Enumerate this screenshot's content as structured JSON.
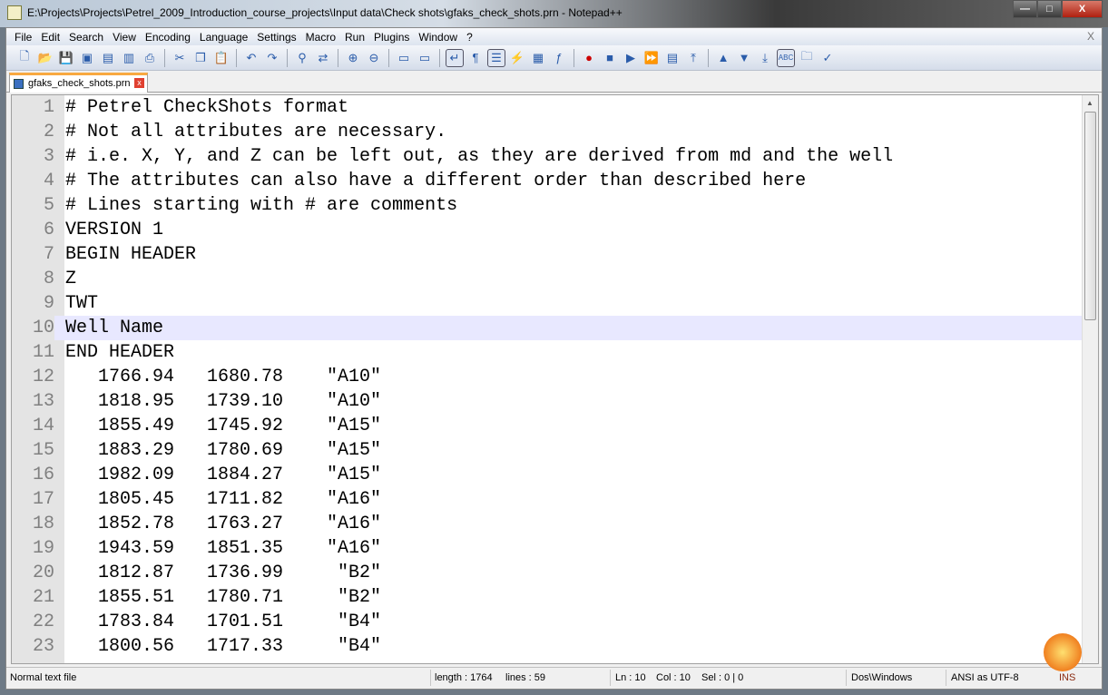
{
  "window": {
    "title": "E:\\Projects\\Projects\\Petrel_2009_Introduction_course_projects\\Input data\\Check shots\\gfaks_check_shots.prn - Notepad++",
    "minimize": "—",
    "maximize": "□",
    "close": "X"
  },
  "menu": [
    "File",
    "Edit",
    "Search",
    "View",
    "Encoding",
    "Language",
    "Settings",
    "Macro",
    "Run",
    "Plugins",
    "Window",
    "?"
  ],
  "menu_close": "X",
  "toolbar": [
    "new-file",
    "open-file",
    "save",
    "save-all",
    "close",
    "close-all",
    "print",
    "cut",
    "copy",
    "paste",
    "undo",
    "redo",
    "find",
    "replace",
    "zoom-in",
    "zoom-out",
    "sync-vertical",
    "sync-horizontal",
    "word-wrap",
    "show-all-chars",
    "indent-guide",
    "user-defined-language",
    "doc-map",
    "function-list",
    "record-macro",
    "stop-recording",
    "playback",
    "run-macro-multiple",
    "save-macro",
    "first-change",
    "prev-change",
    "next-change",
    "last-change",
    "spell-check",
    "folder-as-workspace",
    "spell-check-auto"
  ],
  "tab": {
    "label": "gfaks_check_shots.prn",
    "close": "x"
  },
  "editor": {
    "current_line": 10,
    "lines": [
      "# Petrel CheckShots format",
      "# Not all attributes are necessary.",
      "# i.e. X, Y, and Z can be left out, as they are derived from md and the well",
      "# The attributes can also have a different order than described here",
      "# Lines starting with # are comments",
      "VERSION 1",
      "BEGIN HEADER",
      "Z",
      "TWT",
      "Well Name",
      "END HEADER",
      "   1766.94   1680.78    \"A10\"",
      "   1818.95   1739.10    \"A10\"",
      "   1855.49   1745.92    \"A15\"",
      "   1883.29   1780.69    \"A15\"",
      "   1982.09   1884.27    \"A15\"",
      "   1805.45   1711.82    \"A16\"",
      "   1852.78   1763.27    \"A16\"",
      "   1943.59   1851.35    \"A16\"",
      "   1812.87   1736.99     \"B2\"",
      "   1855.51   1780.71     \"B2\"",
      "   1783.84   1701.51     \"B4\"",
      "   1800.56   1717.33     \"B4\""
    ]
  },
  "status": {
    "type": "Normal text file",
    "length": "length : 1764",
    "lines": "lines : 59",
    "ln": "Ln : 10",
    "col": "Col : 10",
    "sel": "Sel : 0 | 0",
    "eol": "Dos\\Windows",
    "encoding": "ANSI as UTF-8",
    "mode": "INS"
  }
}
